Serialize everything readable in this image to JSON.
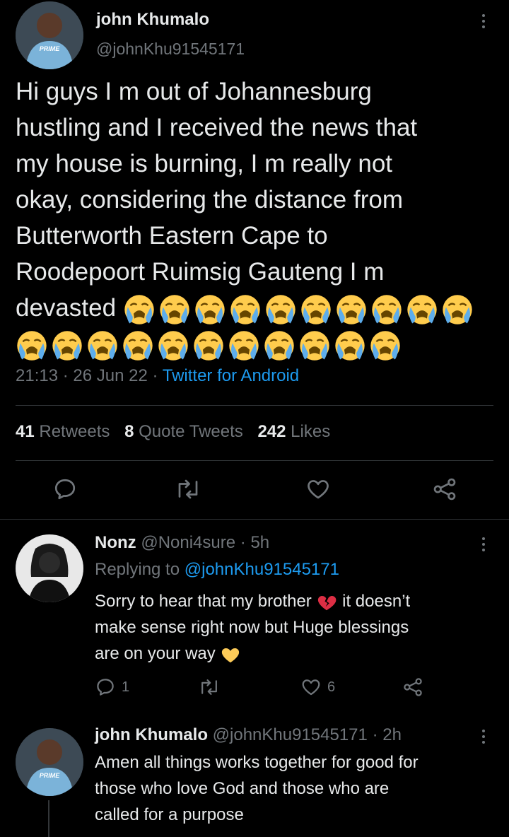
{
  "main_tweet": {
    "author_name": "john Khumalo",
    "author_handle": "@johnKhu91545171",
    "avatar_badge": "PRIME",
    "text_lines": [
      "Hi guys I m out of Johannesburg",
      "hustling and I received the news that",
      "my house is burning, I m really not",
      "okay, considering the distance from",
      "Butterworth Eastern Cape to",
      "Roodepoort Ruimsig Gauteng I m"
    ],
    "last_line_word": "devasted",
    "emoji_name": "loudly-crying-face",
    "emoji_count_line1": 10,
    "emoji_count_line2": 11,
    "time": "21:13",
    "date": "26 Jun 22",
    "source": "Twitter for Android",
    "meta_sep": "·",
    "retweets_count": "41",
    "retweets_label": "Retweets",
    "quotes_count": "8",
    "quotes_label": "Quote Tweets",
    "likes_count": "242",
    "likes_label": "Likes"
  },
  "replies": [
    {
      "author_name": "Nonz",
      "author_handle": "@Noni4sure",
      "age": "5h",
      "sep": "·",
      "replying_to_label": "Replying to",
      "replying_to_handle": "@johnKhu91545171",
      "line1_before": "Sorry to hear that my brother",
      "line1_after": "it doesn’t",
      "line2": "make sense right now but Huge blessings",
      "line3": "are on your way",
      "reply_count": "1",
      "retweet_count": "",
      "like_count": "6"
    },
    {
      "author_name": "john Khumalo",
      "author_handle": "@johnKhu91545171",
      "age": "2h",
      "sep": "·",
      "avatar_badge": "PRIME",
      "lines": [
        "Amen all things works together for good for",
        "those who love God and those who are",
        "called for a purpose"
      ]
    }
  ],
  "colors": {
    "background": "#000000",
    "text": "#e7e9ea",
    "muted": "#71767b",
    "link": "#1d9bf0",
    "divider": "#2f3336"
  }
}
